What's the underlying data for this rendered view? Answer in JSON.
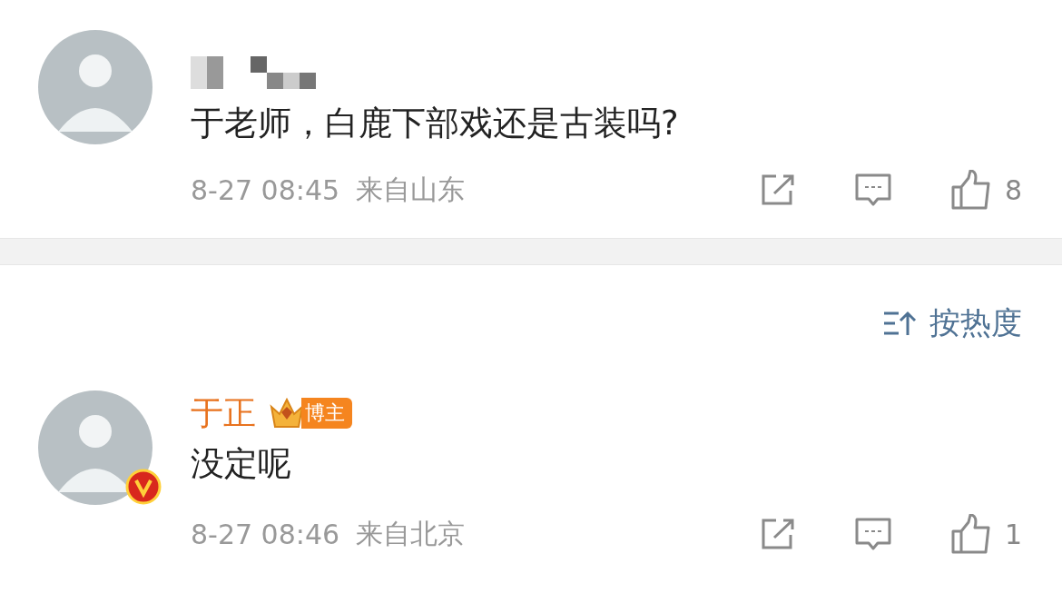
{
  "comments": [
    {
      "name_hidden": true,
      "verified": false,
      "text": "于老师，白鹿下部戏还是古装吗?",
      "time": "8-27 08:45",
      "location": "来自山东",
      "likes": "8"
    },
    {
      "name_hidden": false,
      "author": "于正",
      "badge": "博主",
      "verified": true,
      "text": "没定呢",
      "time": "8-27 08:46",
      "location": "来自北京",
      "likes": "1"
    }
  ],
  "sort": {
    "label": "按热度"
  }
}
